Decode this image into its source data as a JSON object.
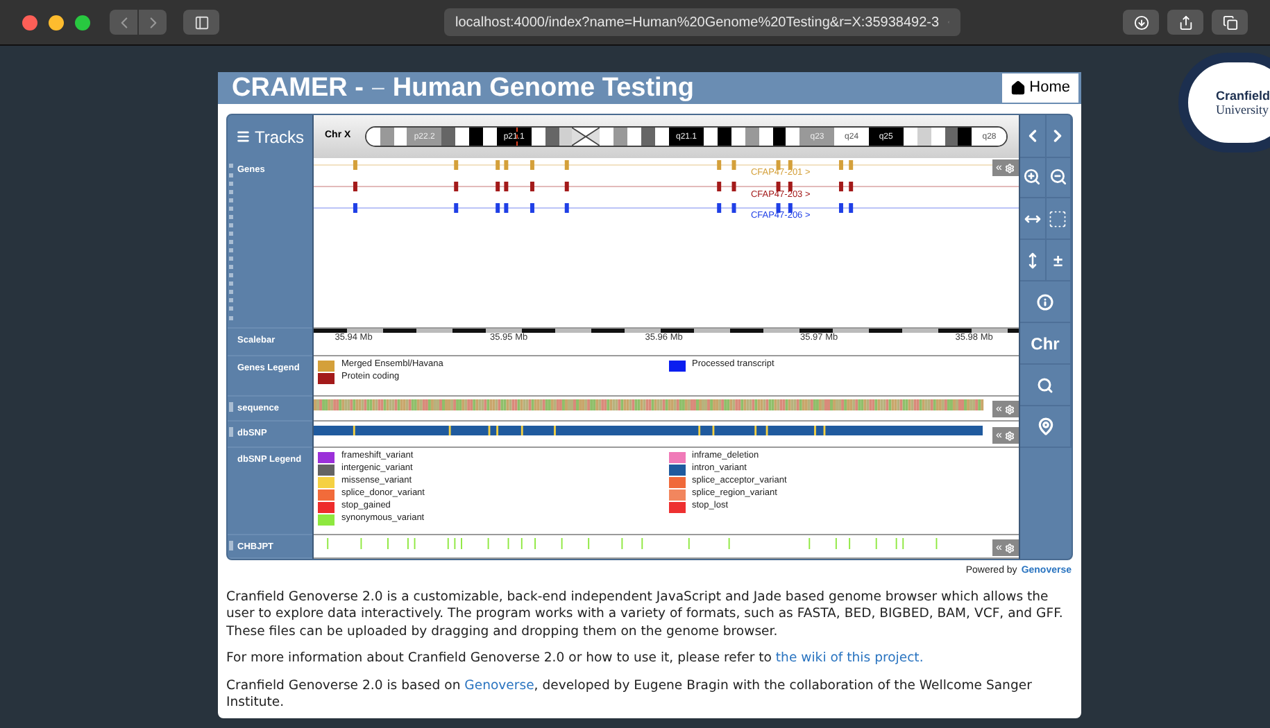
{
  "browser_bar": {
    "url": "localhost:4000/index?name=Human%20Genome%20Testing&r=X:35938492-3"
  },
  "logo": {
    "lines": [
      "Cranfield",
      "University"
    ]
  },
  "header": {
    "title": "CRAMER -",
    "separator": "–",
    "subtitle": "Human Genome Testing",
    "home": "Home"
  },
  "genome_browser": {
    "tracks_button": "Tracks",
    "chromosome": "Chr X",
    "bands": [
      {
        "color": "#ffffff"
      },
      {
        "color": "#999999"
      },
      {
        "color": "#ffffff"
      },
      {
        "color": "#999999",
        "label": "p22.2"
      },
      {
        "color": "#666666"
      },
      {
        "color": "#ffffff"
      },
      {
        "color": "#000000"
      },
      {
        "color": "#ffffff"
      },
      {
        "color": "#000000",
        "label": "p21.1"
      },
      {
        "color": "#ffffff"
      },
      {
        "color": "#666666"
      },
      {
        "color": "#d0d0d0"
      },
      {
        "kind": "centromere"
      },
      {
        "color": "#ffffff"
      },
      {
        "color": "#999999"
      },
      {
        "color": "#ffffff"
      },
      {
        "color": "#666666"
      },
      {
        "color": "#ffffff"
      },
      {
        "color": "#000000",
        "label": "q21.1"
      },
      {
        "color": "#ffffff"
      },
      {
        "color": "#000000"
      },
      {
        "color": "#ffffff"
      },
      {
        "color": "#999999"
      },
      {
        "color": "#ffffff"
      },
      {
        "color": "#000000"
      },
      {
        "color": "#ffffff"
      },
      {
        "color": "#999999",
        "label": "q23"
      },
      {
        "color": "#ffffff",
        "label": "q24"
      },
      {
        "color": "#000000",
        "label": "q25"
      },
      {
        "color": "#ffffff"
      },
      {
        "color": "#d0d0d0"
      },
      {
        "color": "#ffffff"
      },
      {
        "color": "#666666"
      },
      {
        "color": "#000000"
      },
      {
        "color": "#ffffff",
        "label": "q28"
      }
    ],
    "tracks": [
      {
        "kind": "genes",
        "label": "Genes",
        "movable": true,
        "toggle": "«",
        "transcripts": [
          {
            "name": "CFAP47-201 >",
            "color": "#d4a03a"
          },
          {
            "name": "CFAP47-203 >",
            "color": "#a31a1a"
          },
          {
            "name": "CFAP47-206 >",
            "color": "#1f3fe6"
          }
        ]
      },
      {
        "kind": "scalebar",
        "label": "Scalebar",
        "movable": false,
        "ticks": [
          "35.94 Mb",
          "35.95 Mb",
          "35.96 Mb",
          "35.97 Mb",
          "35.98 Mb"
        ]
      },
      {
        "kind": "legend",
        "label": "Genes Legend",
        "movable": false,
        "columns": [
          [
            {
              "label": "Merged Ensembl/Havana",
              "color": "#d4a03a"
            },
            {
              "label": "Protein coding",
              "color": "#a31a1a"
            }
          ],
          [
            {
              "label": "Processed transcript",
              "color": "#0a1ef0"
            }
          ]
        ]
      },
      {
        "kind": "sequence",
        "label": "sequence",
        "movable": true,
        "toggle": "«"
      },
      {
        "kind": "snp",
        "label": "dbSNP",
        "movable": true,
        "toggle": "«"
      },
      {
        "kind": "legend",
        "label": "dbSNP Legend",
        "movable": false,
        "columns": [
          [
            {
              "label": "frameshift_variant",
              "color": "#9b30d9"
            },
            {
              "label": "intergenic_variant",
              "color": "#636363"
            },
            {
              "label": "missense_variant",
              "color": "#f5d142"
            },
            {
              "label": "splice_donor_variant",
              "color": "#f26b3a"
            },
            {
              "label": "stop_gained",
              "color": "#ee2c2c"
            },
            {
              "label": "synonymous_variant",
              "color": "#8ee83f"
            }
          ],
          [
            {
              "label": "inframe_deletion",
              "color": "#f07ab8"
            },
            {
              "label": "intron_variant",
              "color": "#1f5a9e"
            },
            {
              "label": "splice_acceptor_variant",
              "color": "#f0693a"
            },
            {
              "label": "splice_region_variant",
              "color": "#f2865e"
            },
            {
              "label": "stop_lost",
              "color": "#ee3030"
            }
          ]
        ]
      },
      {
        "kind": "variants",
        "label": "CHBJPT",
        "movable": true,
        "toggle": "«"
      }
    ],
    "controls": [
      {
        "kind": "prev"
      },
      {
        "kind": "next"
      },
      {
        "kind": "zoom-in"
      },
      {
        "kind": "zoom-out"
      },
      {
        "kind": "expand-horizontal"
      },
      {
        "kind": "select"
      },
      {
        "kind": "expand-vertical"
      },
      {
        "kind": "text",
        "label": "±"
      },
      {
        "kind": "info"
      },
      {
        "kind": "wide-text",
        "label": "Chr"
      },
      {
        "kind": "search"
      },
      {
        "kind": "pin"
      }
    ],
    "powered_by": {
      "text": "Powered by",
      "link": "Genoverse"
    }
  },
  "paragraphs": [
    [
      {
        "text": "Cranfield Genoverse 2.0 is a customizable, back-end independent JavaScript and Jade based genome browser which allows the user to explore data interactively. The program works with a variety of formats, such as FASTA, BED, BIGBED, BAM, VCF, and GFF. These files can be uploaded by dragging and dropping them on the genome browser."
      }
    ],
    [
      {
        "text": "For more information about Cranfield Genoverse 2.0 or how to use it, please refer to "
      },
      {
        "link": "the wiki of this project."
      }
    ],
    [
      {
        "text": "Cranfield Genoverse 2.0 is based on "
      },
      {
        "link": "Genoverse"
      },
      {
        "text": ", developed by Eugene Bragin with the collaboration of the Wellcome Sanger Institute."
      }
    ]
  ]
}
